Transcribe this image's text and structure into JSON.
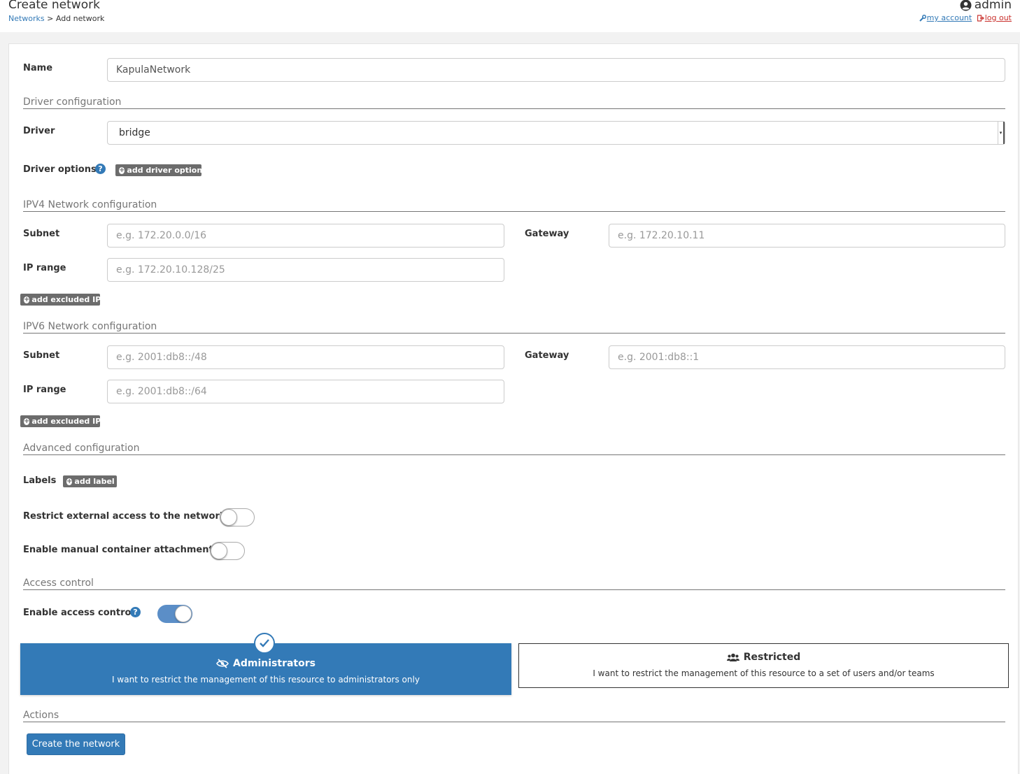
{
  "header": {
    "title": "Create network",
    "breadcrumb_link": "Networks",
    "breadcrumb_sep": ">",
    "breadcrumb_current": "Add network",
    "user": "admin",
    "my_account": "my account",
    "log_out": "log out"
  },
  "form": {
    "name_label": "Name",
    "name_value": "KapulaNetwork",
    "driver_section": "Driver configuration",
    "driver_label": "Driver",
    "driver_value": "bridge",
    "driver_options_label": "Driver options",
    "add_driver_option": "add driver option",
    "ipv4_section": "IPV4 Network configuration",
    "ipv4": {
      "subnet_label": "Subnet",
      "subnet_placeholder": "e.g. 172.20.0.0/16",
      "gateway_label": "Gateway",
      "gateway_placeholder": "e.g. 172.20.10.11",
      "iprange_label": "IP range",
      "iprange_placeholder": "e.g. 172.20.10.128/25",
      "add_excluded": "add excluded IP"
    },
    "ipv6_section": "IPV6 Network configuration",
    "ipv6": {
      "subnet_label": "Subnet",
      "subnet_placeholder": "e.g. 2001:db8::/48",
      "gateway_label": "Gateway",
      "gateway_placeholder": "e.g. 2001:db8::1",
      "iprange_label": "IP range",
      "iprange_placeholder": "e.g. 2001:db8::/64",
      "add_excluded": "add excluded IP"
    },
    "advanced_section": "Advanced configuration",
    "labels_label": "Labels",
    "add_label": "add label",
    "restrict_external_label": "Restrict external access to the network",
    "restrict_external_on": false,
    "manual_attach_label": "Enable manual container attachment",
    "manual_attach_on": false,
    "access_section": "Access control",
    "enable_access_label": "Enable access control",
    "enable_access_on": true,
    "admin_box": {
      "title": "Administrators",
      "desc": "I want to restrict the management of this resource to administrators only"
    },
    "restricted_box": {
      "title": "Restricted",
      "desc": "I want to restrict the management of this resource to a set of users and/or teams"
    },
    "actions_section": "Actions",
    "create_button": "Create the network"
  },
  "colors": {
    "primary": "#337ab7",
    "badge": "#6c6c6c",
    "danger": "#c9302c"
  }
}
